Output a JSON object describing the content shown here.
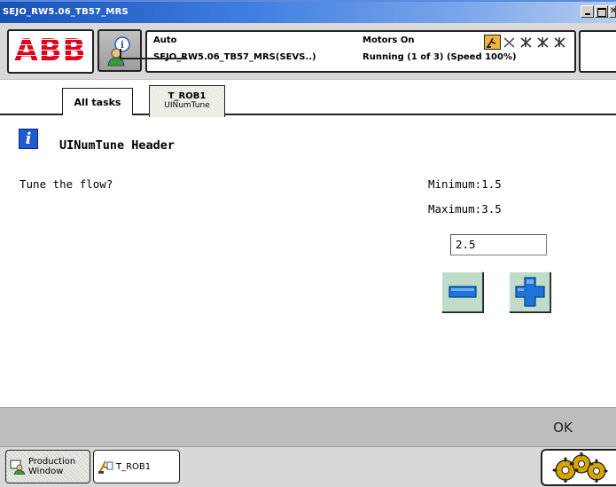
{
  "window": {
    "title": "SEJO_RW5.06_TB57_MRS"
  },
  "status": {
    "logo": "ABB",
    "mode": "Auto",
    "program": "SEJO_RW5.06_TB57_MRS(SEVS..)",
    "motors": "Motors On",
    "running": "Running (1 of 3) (Speed 100%)"
  },
  "tasks": {
    "all_tasks": "All tasks",
    "active_name": "T_ROB1",
    "active_sub": "UINumTune"
  },
  "dialog": {
    "header": "UINumTune Header",
    "question": "Tune the flow?",
    "minimum": "Minimum:1.5",
    "maximum": "Maximum:3.5",
    "value": "2.5"
  },
  "commands": {
    "ok": "OK"
  },
  "taskbar": {
    "production_line1": "Production",
    "production_line2": "Window",
    "trob1": "T_ROB1"
  },
  "colors": {
    "abb_red": "#e2001a",
    "titlebar_blue": "#1a52b8",
    "info_blue": "#1f5bd1",
    "stepper_green": "#bedcc7"
  }
}
